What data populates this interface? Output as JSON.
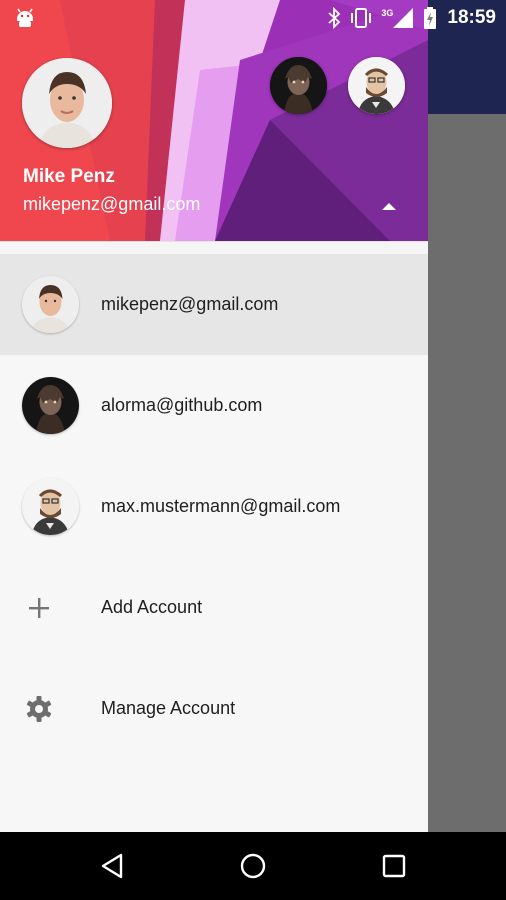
{
  "status_bar": {
    "time": "18:59",
    "network": "3G",
    "icons": [
      "android-icon",
      "bluetooth-icon",
      "vibrate-icon",
      "signal-icon",
      "battery-charging-icon"
    ]
  },
  "header": {
    "name": "Mike Penz",
    "email": "mikepenz@gmail.com",
    "toggle_icon": "arrow-up-icon",
    "colors": {
      "left": "#f0484f",
      "right": "#9b2fb6"
    }
  },
  "accounts": [
    {
      "email": "mikepenz@gmail.com",
      "selected": true
    },
    {
      "email": "alorma@github.com",
      "selected": false
    },
    {
      "email": "max.mustermann@gmail.com",
      "selected": false
    }
  ],
  "actions": [
    {
      "label": "Add Account",
      "icon": "plus-icon"
    },
    {
      "label": "Manage Account",
      "icon": "gear-icon"
    }
  ],
  "navbar": {
    "icons": [
      "back-icon",
      "home-icon",
      "recents-icon"
    ]
  },
  "colors": {
    "app_toolbar": "#1d2550",
    "scrim": "#6d6d6d",
    "selected_row": "#e6e6e6"
  }
}
